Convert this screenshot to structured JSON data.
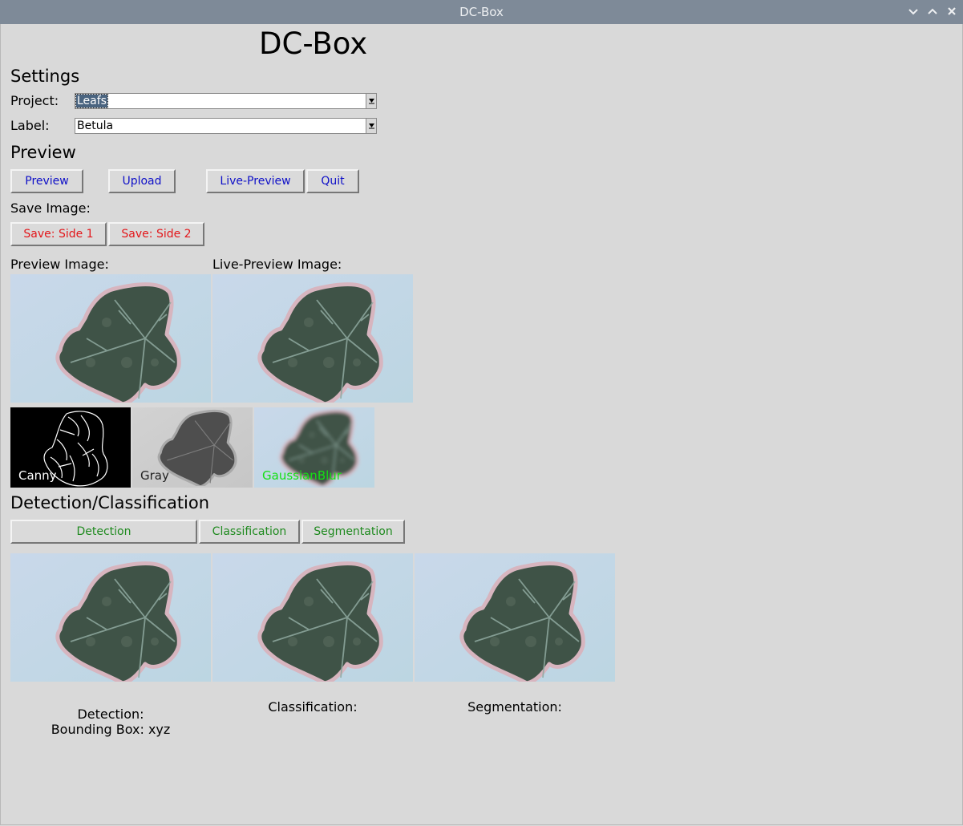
{
  "window": {
    "title": "DC-Box"
  },
  "app": {
    "title": "DC-Box"
  },
  "settings": {
    "heading": "Settings",
    "project_label": "Project:",
    "project_value": "Leafs",
    "label_label": "Label:",
    "label_value": "Betula"
  },
  "preview": {
    "heading": "Preview",
    "buttons": {
      "preview": "Preview",
      "upload": "Upload",
      "live_preview": "Live-Preview",
      "quit": "Quit"
    },
    "save_label": "Save Image:",
    "save_side1": "Save: Side 1",
    "save_side2": "Save: Side 2",
    "preview_image_label": "Preview Image:",
    "live_preview_image_label": "Live-Preview Image:",
    "filters": {
      "canny": "Canny",
      "gray": "Gray",
      "gaussian": "GaussianBlur"
    }
  },
  "detection": {
    "heading": "Detection/Classification",
    "buttons": {
      "detection": "Detection",
      "classification": "Classification",
      "segmentation": "Segmentation"
    },
    "detection_result": "Detection:",
    "bounding_box": "Bounding Box: xyz",
    "classification_result": "Classification:",
    "segmentation_result": "Segmentation:"
  },
  "colors": {
    "blue_button_text": "#0f10c8",
    "red_button_text": "#e3161a",
    "green_button_text": "#1f8a1f",
    "titlebar": "#7e8a98",
    "background": "#d9d9d9",
    "selection": "#4a6480"
  }
}
